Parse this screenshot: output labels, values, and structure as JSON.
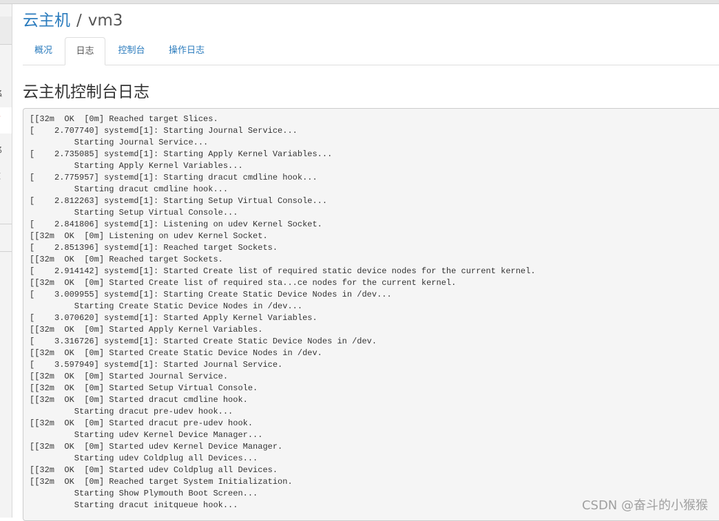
{
  "breadcrumb": {
    "parent": "云主机",
    "separator": "/",
    "current": "vm3"
  },
  "tabs": [
    {
      "label": "概况"
    },
    {
      "label": "日志"
    },
    {
      "label": "控制台"
    },
    {
      "label": "操作日志"
    }
  ],
  "active_tab": "日志",
  "section_title": "云主机控制台日志",
  "console_log": "[[32m  OK  [0m] Reached target Slices.\n[    2.707740] systemd[1]: Starting Journal Service...\n         Starting Journal Service...\n[    2.735085] systemd[1]: Starting Apply Kernel Variables...\n         Starting Apply Kernel Variables...\n[    2.775957] systemd[1]: Starting dracut cmdline hook...\n         Starting dracut cmdline hook...\n[    2.812263] systemd[1]: Starting Setup Virtual Console...\n         Starting Setup Virtual Console...\n[    2.841806] systemd[1]: Listening on udev Kernel Socket.\n[[32m  OK  [0m] Listening on udev Kernel Socket.\n[    2.851396] systemd[1]: Reached target Sockets.\n[[32m  OK  [0m] Reached target Sockets.\n[    2.914142] systemd[1]: Started Create list of required static device nodes for the current kernel.\n[[32m  OK  [0m] Started Create list of required sta...ce nodes for the current kernel.\n[    3.009955] systemd[1]: Starting Create Static Device Nodes in /dev...\n         Starting Create Static Device Nodes in /dev...\n[    3.070620] systemd[1]: Started Apply Kernel Variables.\n[[32m  OK  [0m] Started Apply Kernel Variables.\n[    3.316726] systemd[1]: Started Create Static Device Nodes in /dev.\n[[32m  OK  [0m] Started Create Static Device Nodes in /dev.\n[    3.597949] systemd[1]: Started Journal Service.\n[[32m  OK  [0m] Started Journal Service.\n[[32m  OK  [0m] Started Setup Virtual Console.\n[[32m  OK  [0m] Started dracut cmdline hook.\n         Starting dracut pre-udev hook...\n[[32m  OK  [0m] Started dracut pre-udev hook.\n         Starting udev Kernel Device Manager...\n[[32m  OK  [0m] Started udev Kernel Device Manager.\n         Starting udev Coldplug all Devices...\n[[32m  OK  [0m] Started udev Coldplug all Devices.\n[[32m  OK  [0m] Reached target System Initialization.\n         Starting Show Plymouth Boot Screen...\n         Starting dracut initqueue hook...",
  "watermark": "CSDN @奋斗的小猴猴",
  "colors": {
    "link": "#2a7bbd",
    "active_sidebar": "#d44a35",
    "console_bg": "#f5f5f5"
  }
}
